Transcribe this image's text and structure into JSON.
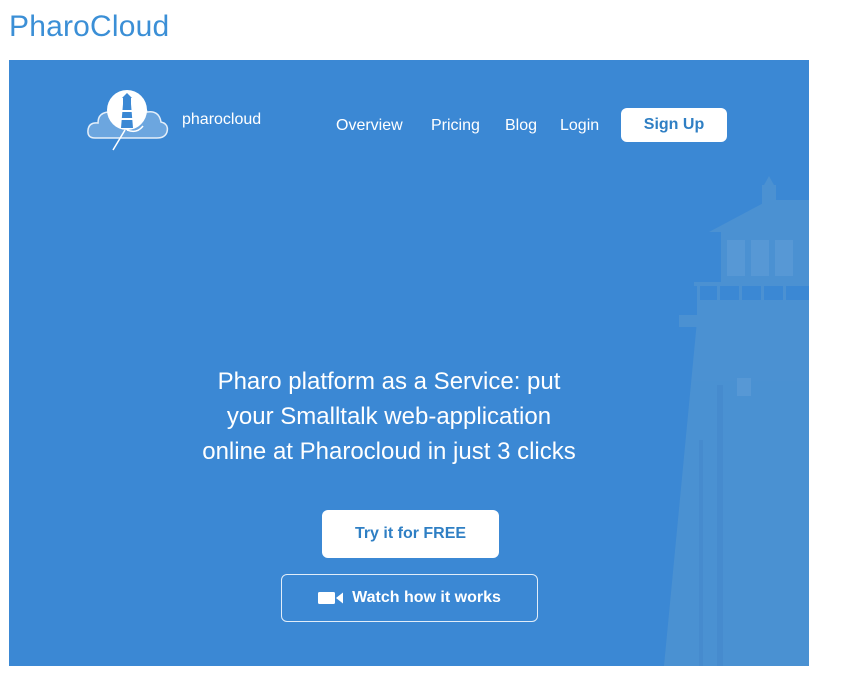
{
  "page": {
    "heading": "PharoCloud"
  },
  "header": {
    "logo_text": "pharocloud",
    "logo_icon": "lighthouse-cloud-logo-icon",
    "nav": [
      {
        "label": "Overview"
      },
      {
        "label": "Pricing"
      },
      {
        "label": "Blog"
      },
      {
        "label": "Login"
      }
    ],
    "signup_label": "Sign Up"
  },
  "hero": {
    "line1": "Pharo platform as a Service: put",
    "line2": "your Smalltalk web-application",
    "line3": "online at Pharocloud in just 3 clicks",
    "try_label": "Try it for FREE",
    "watch_label": "Watch how it works",
    "watch_icon": "video-camera-icon",
    "background_icon": "lighthouse-icon"
  },
  "colors": {
    "heading": "#3b8fd6",
    "hero_bg": "#3b88d4",
    "button_text": "#2f7fc4",
    "white": "#ffffff"
  }
}
